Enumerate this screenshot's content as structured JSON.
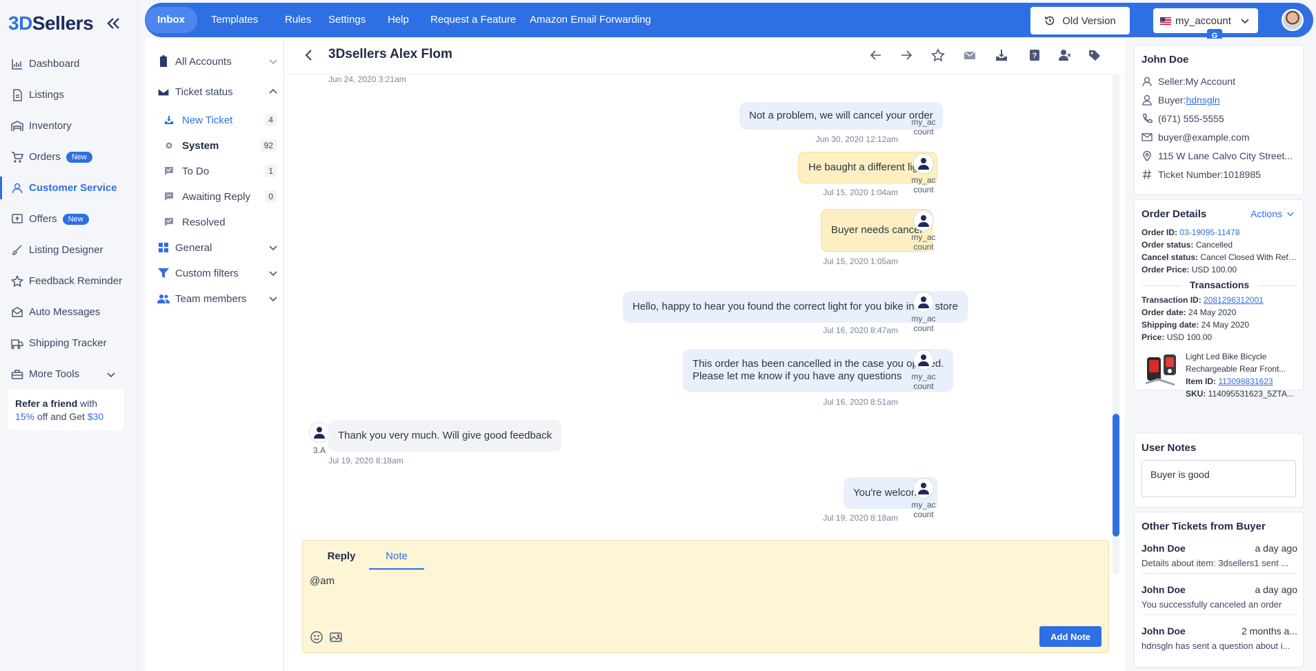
{
  "brand": {
    "prefix": "3D",
    "name": "Sellers"
  },
  "sidebar": {
    "items": [
      {
        "label": "Dashboard",
        "icon": "chart-icon"
      },
      {
        "label": "Listings",
        "icon": "document-icon"
      },
      {
        "label": "Inventory",
        "icon": "warehouse-icon"
      },
      {
        "label": "Orders",
        "icon": "cart-icon",
        "badge": "New"
      },
      {
        "label": "Customer Service",
        "icon": "headset-icon",
        "active": true
      },
      {
        "label": "Offers",
        "icon": "offer-icon",
        "badge": "New"
      },
      {
        "label": "Listing Designer",
        "icon": "brush-icon"
      },
      {
        "label": "Feedback Reminder",
        "icon": "star-icon"
      },
      {
        "label": "Auto Messages",
        "icon": "envelope-icon"
      },
      {
        "label": "Shipping Tracker",
        "icon": "truck-icon"
      },
      {
        "label": "More Tools",
        "icon": "toolbox-icon"
      }
    ],
    "refer": {
      "bold": "Refer a friend",
      "with": " with ",
      "pct": "15%",
      "off": " off and Get ",
      "amount": "$30"
    }
  },
  "topbar": {
    "tabs": [
      "Inbox",
      "Templates",
      "Rules",
      "Settings",
      "Help",
      "Request a Feature",
      "Amazon Email Forwarding"
    ],
    "old_version": "Old Version",
    "account": "my_account",
    "translate_glyph": "G"
  },
  "folders": {
    "all_accounts": "All Accounts",
    "ticket_status": "Ticket status",
    "statuses": [
      {
        "label": "New Ticket",
        "count": "4"
      },
      {
        "label": "System",
        "count": "92"
      },
      {
        "label": "To Do",
        "count": "1"
      },
      {
        "label": "Awaiting Reply",
        "count": "0"
      },
      {
        "label": "Resolved",
        "count": ""
      }
    ],
    "general": "General",
    "custom_filters": "Custom filters",
    "team_members": "Team members"
  },
  "conversation": {
    "title": "3Dsellers Alex Flom",
    "top_timestamp": "Jun 24, 2020 3:21am",
    "messages": [
      {
        "text": "Not a problem, we will cancel your order",
        "time": "Jun 30, 2020 12:12am",
        "who1": "my_ac",
        "who2": "count"
      },
      {
        "text": "He baught a different light",
        "time": "Jul 15, 2020 1:04am",
        "who1": "my_ac",
        "who2": "count"
      },
      {
        "text": "Buyer needs cancel",
        "time": "Jul 15, 2020 1:05am",
        "who1": "my_ac",
        "who2": "count"
      },
      {
        "text": "Hello, happy to hear you found the correct light for you bike in our store",
        "time": "Jul 16, 2020 8:47am",
        "who1": "my_ac",
        "who2": "count"
      },
      {
        "line1": "This order has been cancelled in the case you opened.",
        "line2": "Please let me know if you have any questions",
        "time": "Jul 16, 2020 8:51am",
        "who1": "my_ac",
        "who2": "count"
      },
      {
        "text": "Thank you very much. Will give good feedback",
        "time": "Jul 19, 2020 8:18am",
        "who1": "3.A"
      },
      {
        "text": "You're welcome!",
        "time": "Jul 19, 2020 8:18am",
        "who1": "my_ac",
        "who2": "count"
      }
    ],
    "composer": {
      "reply_tab": "Reply",
      "note_tab": "Note",
      "text": "@am",
      "add_note": "Add Note"
    }
  },
  "buyer": {
    "name": "John Doe",
    "seller_label": "Seller: ",
    "seller": "My Account",
    "buyer_label": "Buyer: ",
    "buyer": "hdnsgln",
    "phone": "(671) 555-5555",
    "email": "buyer@example.com",
    "address": "115 W Lane Calvo City Street...",
    "ticket_label": "Ticket Number: ",
    "ticket": "1018985"
  },
  "order": {
    "title": "Order Details",
    "actions": "Actions",
    "order_id_label": "Order ID: ",
    "order_id": "03-19095-11478",
    "status_label": "Order status: ",
    "status": "Cancelled",
    "cancel_label": "Cancel status: ",
    "cancel": "Cancel Closed With Refu...",
    "price_label": "Order Price: ",
    "price": "USD 100.00",
    "transactions_title": "Transactions",
    "tx_id_label": "Transaction ID: ",
    "tx_id": "2081296312001",
    "order_date_label": "Order date: ",
    "order_date": "24 May 2020",
    "ship_date_label": "Shipping date: ",
    "ship_date": "24 May 2020",
    "tx_price_label": "Price: ",
    "tx_price": "USD 100.00",
    "item_line1": "Light Led Bike Bicycle",
    "item_line2": "Rechargeable Rear Front...",
    "item_id_label": "Item ID: ",
    "item_id": "113098831623",
    "sku_label": "SKU: ",
    "sku": "114095531623_5ZTA..."
  },
  "notes": {
    "title": "User Notes",
    "text": "Buyer is good"
  },
  "other_tickets": {
    "title": "Other Tickets from Buyer",
    "items": [
      {
        "name": "John Doe",
        "ago": "a day ago",
        "desc": "Details about item: 3dsellers1 sent ..."
      },
      {
        "name": "John Doe",
        "ago": "a day ago",
        "desc": "You successfully canceled an order"
      },
      {
        "name": "John Doe",
        "ago": "2 months a...",
        "desc": "hdnsgln has sent a question about i..."
      }
    ]
  },
  "colors": {
    "accent": "#2f6fe4",
    "note_bg": "#fdf5d6",
    "bubble_blue": "#e9f0fc",
    "bubble_yellow": "#fdefc2"
  }
}
